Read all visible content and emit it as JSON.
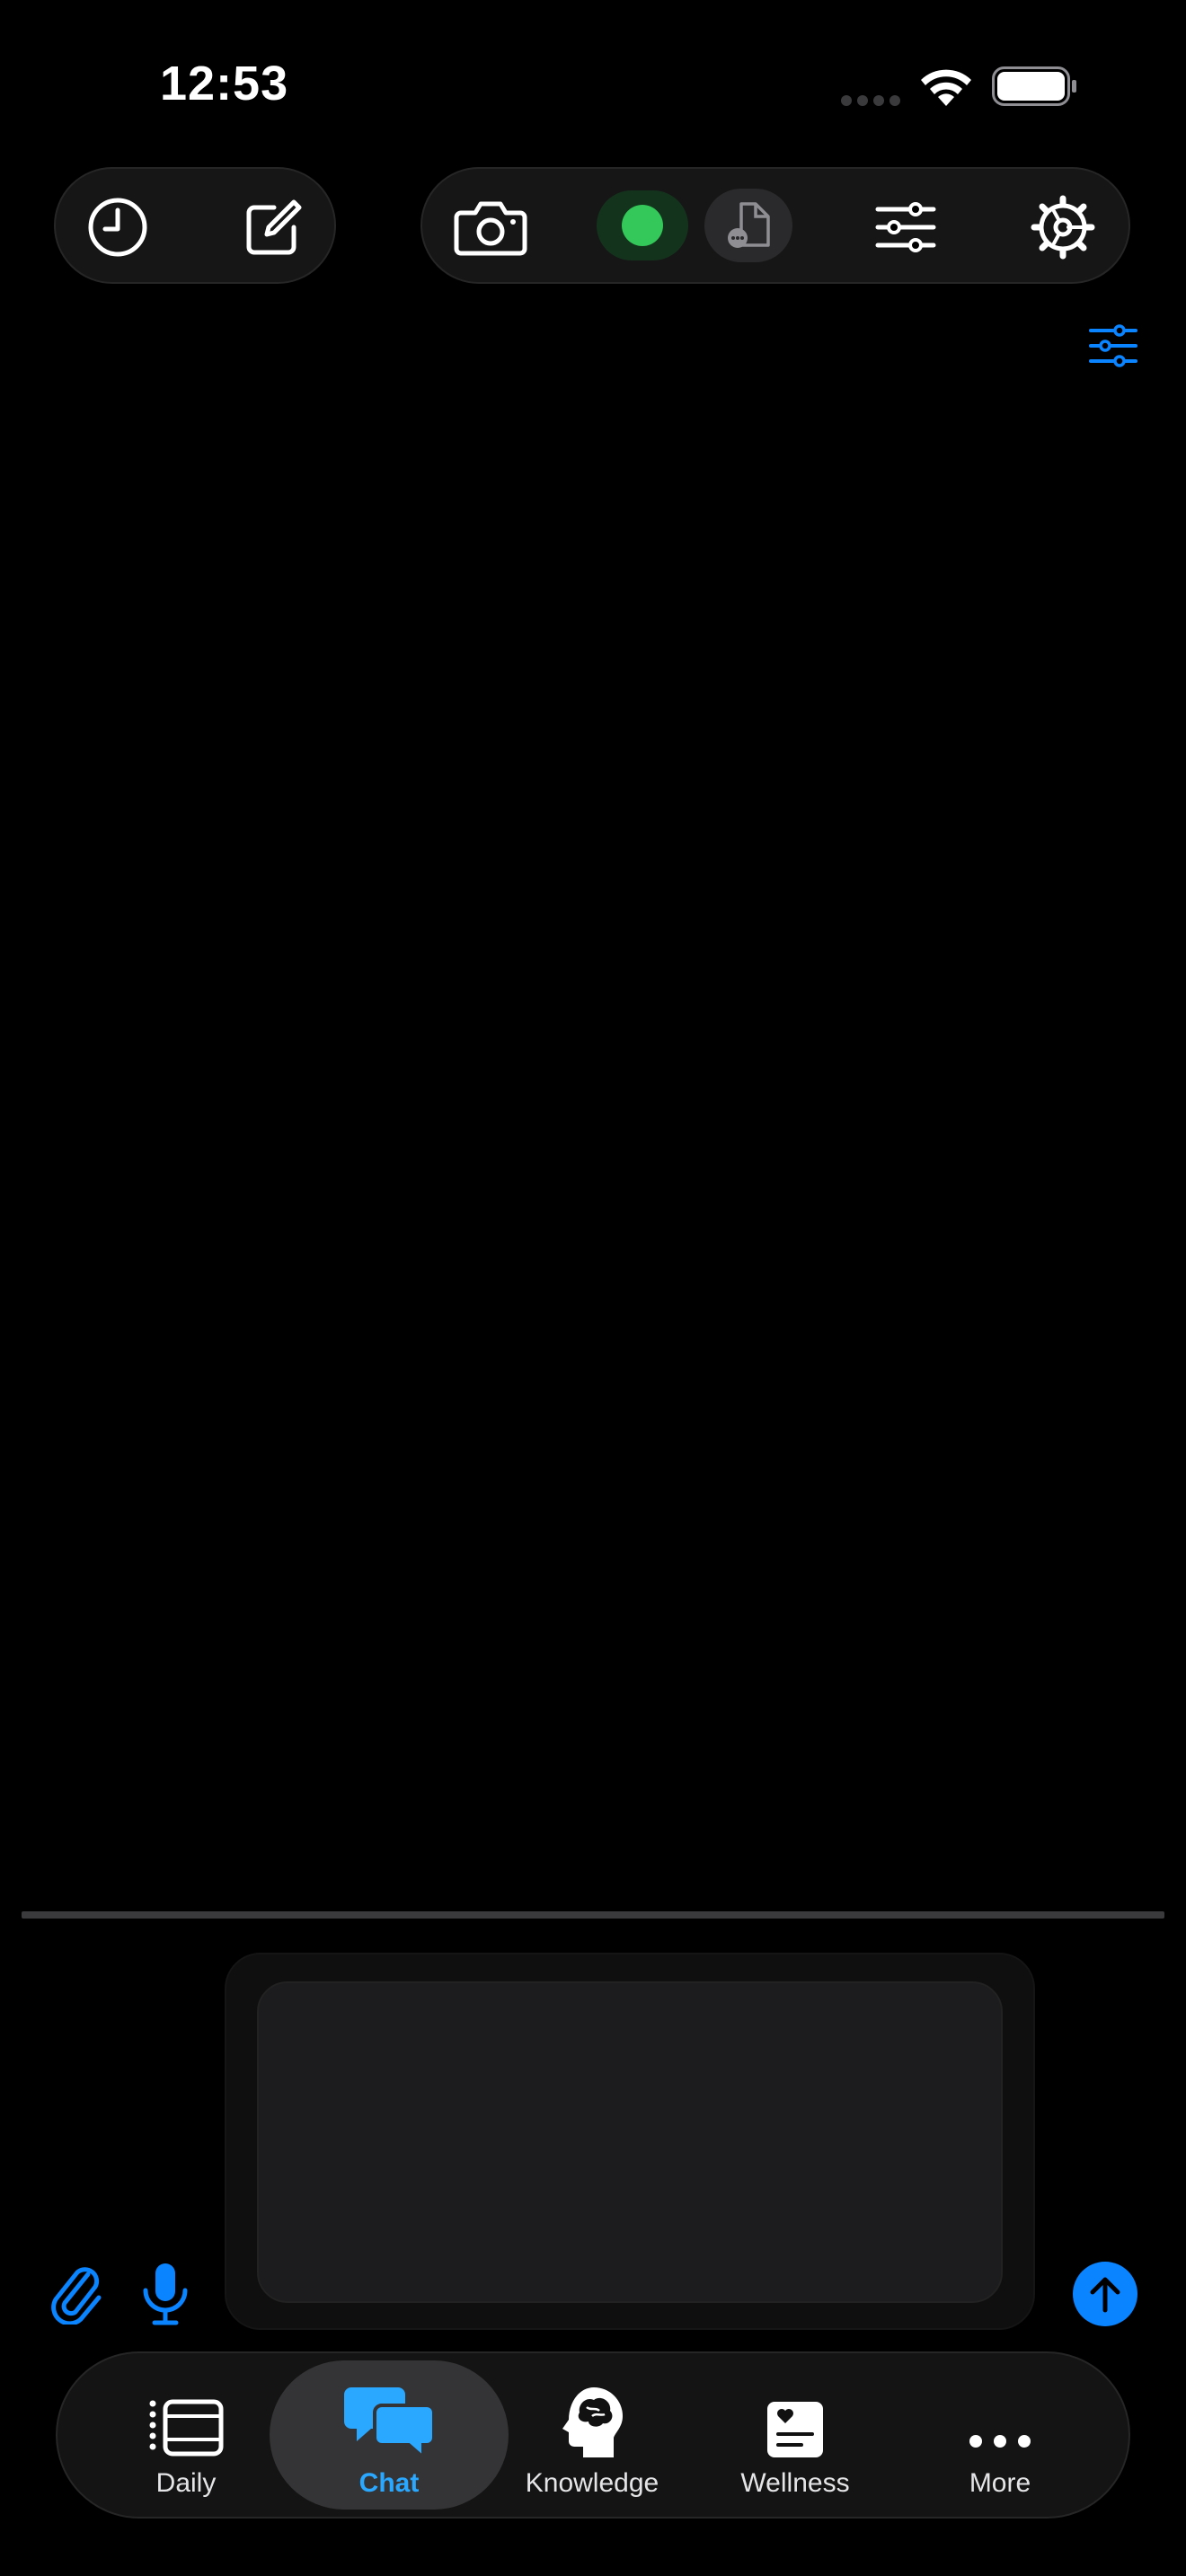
{
  "status_bar": {
    "time": "12:53"
  },
  "toolbar": {
    "history_icon": "clock-icon",
    "compose_icon": "compose-icon",
    "camera_icon": "camera-icon",
    "status_color": "#34c759",
    "document_icon": "document-icon",
    "sliders_icon": "sliders-icon",
    "settings_icon": "gear-icon"
  },
  "chat": {
    "filter_icon": "sliders-icon",
    "accent_color": "#0a84ff"
  },
  "composer": {
    "attach_icon": "paperclip-icon",
    "mic_icon": "microphone-icon",
    "send_icon": "arrow-up-icon"
  },
  "tabbar": {
    "items": [
      {
        "label": "Daily",
        "icon": "daily-list-icon",
        "active": false
      },
      {
        "label": "Chat",
        "icon": "chat-bubbles-icon",
        "active": true
      },
      {
        "label": "Knowledge",
        "icon": "brain-head-icon",
        "active": false
      },
      {
        "label": "Wellness",
        "icon": "wellness-card-icon",
        "active": false
      },
      {
        "label": "More",
        "icon": "more-dots-icon",
        "active": false
      }
    ]
  }
}
